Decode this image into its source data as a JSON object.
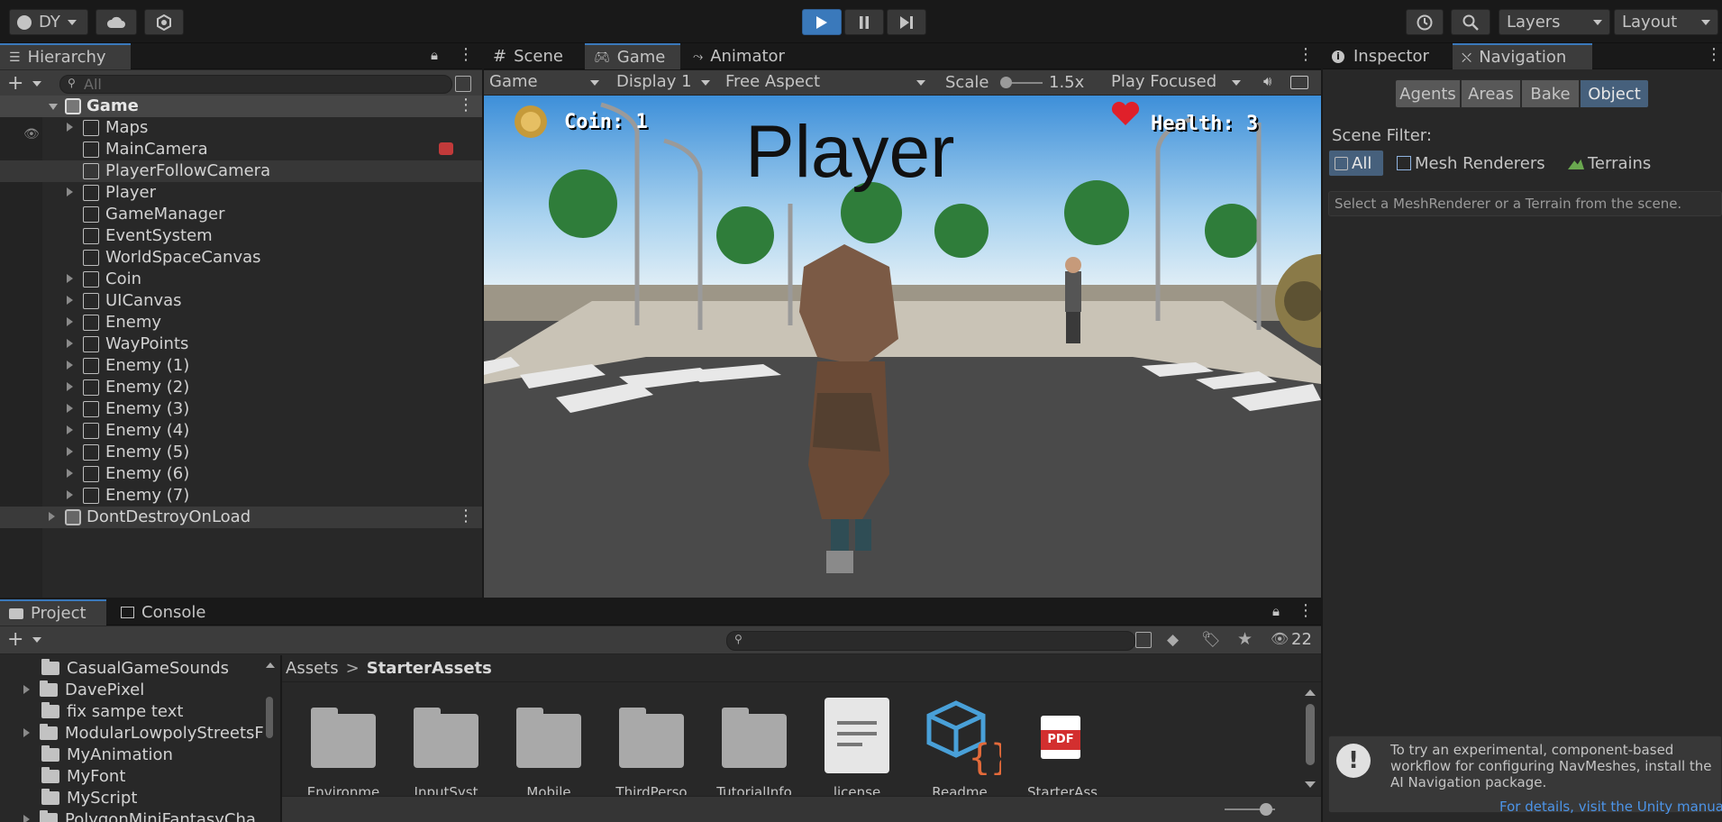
{
  "toolbar": {
    "account": "DY",
    "layers": "Layers",
    "layout": "Layout"
  },
  "hierarchy": {
    "tab": "Hierarchy",
    "search_placeholder": "All",
    "scene": "Game",
    "items": [
      "Maps",
      "MainCamera",
      "PlayerFollowCamera",
      "Player",
      "GameManager",
      "EventSystem",
      "WorldSpaceCanvas",
      "Coin",
      "UICanvas",
      "Enemy",
      "WayPoints",
      "Enemy (1)",
      "Enemy (2)",
      "Enemy (3)",
      "Enemy (4)",
      "Enemy (5)",
      "Enemy (6)",
      "Enemy (7)"
    ],
    "dont_destroy": "DontDestroyOnLoad"
  },
  "view": {
    "tabs": [
      "Scene",
      "Game",
      "Animator"
    ],
    "game_dropdown": "Game",
    "display": "Display 1",
    "aspect": "Free Aspect",
    "scale_label": "Scale",
    "scale_value": "1.5x",
    "play_focused": "Play Focused"
  },
  "game": {
    "coin": "Coin: 1",
    "health": "Health: 3",
    "title": "Player"
  },
  "inspector": {
    "tabs": [
      "Inspector",
      "Navigation"
    ],
    "nav_buttons": [
      "Agents",
      "Areas",
      "Bake",
      "Object"
    ],
    "scene_filter": "Scene Filter:",
    "filters": [
      "All",
      "Mesh Renderers",
      "Terrains"
    ],
    "hint": "Select a MeshRenderer or a Terrain from the scene.",
    "info": "To try an experimental, component-based workflow for configuring NavMeshes, install the AI Navigation package.",
    "link": "For details, visit the Unity manual"
  },
  "project": {
    "tabs": [
      "Project",
      "Console"
    ],
    "hidden_count": "22",
    "tree": [
      "CasualGameSounds",
      "DavePixel",
      "fix sampe text",
      "ModularLowpolyStreetsF",
      "MyAnimation",
      "MyFont",
      "MyScript",
      "PolygonMiniFantasyCha"
    ],
    "breadcrumb": [
      "Assets",
      "StarterAssets"
    ],
    "assets": [
      "Environme",
      "InputSyst",
      "Mobile",
      "ThirdPerso",
      "TutorialInfo",
      "license",
      "Readme",
      "StarterAss"
    ]
  },
  "colors": {
    "accent": "#3a79bb",
    "panel": "#282828",
    "dark": "#191919"
  }
}
